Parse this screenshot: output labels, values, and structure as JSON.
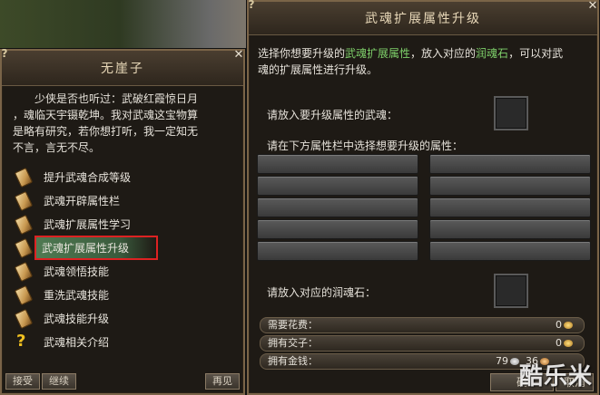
{
  "left_panel": {
    "title": "无崖子",
    "help_glyph": "?",
    "close_glyph": "✕",
    "npc_text": [
      "少侠是否也听过：武破红霞惊日月",
      "，魂临天宇镊乾坤。我对武魂这宝物算",
      "是略有研究，若你想打听，我一定知无",
      "不言，言无不尽。"
    ],
    "options": [
      {
        "label": "提升武魂合成等级",
        "icon": "scroll-icon"
      },
      {
        "label": "武魂开辟属性栏",
        "icon": "scroll-icon"
      },
      {
        "label": "武魂扩展属性学习",
        "icon": "scroll-icon"
      },
      {
        "label": "武魂扩展属性升级",
        "icon": "scroll-icon",
        "selected": true
      },
      {
        "label": "武魂领悟技能",
        "icon": "scroll-icon"
      },
      {
        "label": "重洗武魂技能",
        "icon": "scroll-icon"
      },
      {
        "label": "武魂技能升级",
        "icon": "scroll-icon"
      },
      {
        "label": "武魂相关介绍",
        "icon": "question-icon"
      }
    ],
    "buttons": {
      "accept": "接受",
      "continue": "继续",
      "goodbye": "再见"
    }
  },
  "right_panel": {
    "title": "武魂扩展属性升级",
    "help_glyph": "?",
    "close_glyph": "✕",
    "intro": {
      "part1": "选择你想要升级的",
      "hl1": "武魂扩展属性",
      "part2": "，放入对应的",
      "hl2": "润魂石",
      "part3": "，可以对武",
      "line2": "魂的扩展属性进行升级。"
    },
    "slot1_label": "请放入要升级属性的武魂：",
    "attr_label": "请在下方属性栏中选择想要升级的属性：",
    "slot2_label": "请放入对应的润魂石：",
    "cost_label": "需要花费：",
    "cost_value": "0",
    "jiaozi_label": "拥有交子：",
    "jiaozi_value": "0",
    "money_label": "拥有金钱：",
    "money_silver": "79",
    "money_copper": "36",
    "confirm": "确",
    "cancel": "取消"
  },
  "watermark": "酷乐米"
}
